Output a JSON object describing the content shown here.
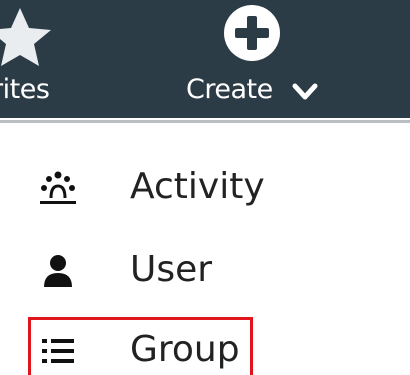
{
  "topbar": {
    "background_color": "#2c3c47",
    "favorites": {
      "label": "orites",
      "icon": "star-icon"
    },
    "create": {
      "label": "Create",
      "icon": "plus-circle-icon",
      "chevron_icon": "chevron-down-icon"
    }
  },
  "menu": {
    "items": [
      {
        "label": "Activity",
        "icon": "activity-people-icon"
      },
      {
        "label": "User",
        "icon": "user-icon"
      },
      {
        "label": "Group",
        "icon": "list-icon"
      }
    ],
    "highlight_color": "#e0161c"
  }
}
